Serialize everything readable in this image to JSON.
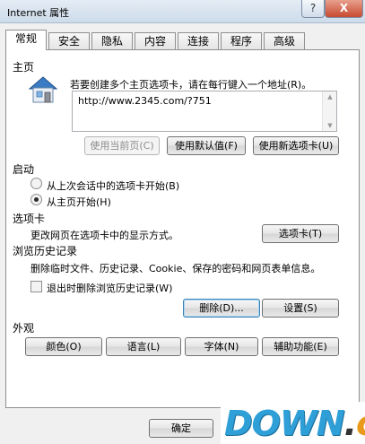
{
  "window": {
    "title": "Internet 属性",
    "help_glyph": "?",
    "close_glyph": "X"
  },
  "tabs": [
    "常规",
    "安全",
    "隐私",
    "内容",
    "连接",
    "程序",
    "高级"
  ],
  "home": {
    "section": "主页",
    "description": "若要创建多个主页选项卡，请在每行键入一个地址(R)。",
    "url": "http://www.2345.com/?751",
    "use_current": "使用当前页(C)",
    "use_default": "使用默认值(F)",
    "use_new_tab": "使用新选项卡(U)"
  },
  "startup": {
    "section": "启动",
    "option_last": "从上次会话中的选项卡开始(B)",
    "option_home": "从主页开始(H)"
  },
  "tabs_section": {
    "section": "选项卡",
    "description": "更改网页在选项卡中的显示方式。",
    "button": "选项卡(T)"
  },
  "history": {
    "section": "浏览历史记录",
    "description": "删除临时文件、历史记录、Cookie、保存的密码和网页表单信息。",
    "delete_on_exit": "退出时删除浏览历史记录(W)",
    "delete_button": "删除(D)...",
    "settings_button": "设置(S)"
  },
  "appearance": {
    "section": "外观",
    "colors": "颜色(O)",
    "languages": "语言(L)",
    "fonts": "字体(N)",
    "accessibility": "辅助功能(E)"
  },
  "footer": {
    "ok": "确定"
  },
  "watermark": {
    "down": "DOWN",
    "dot": ".",
    "cc": "cc"
  }
}
